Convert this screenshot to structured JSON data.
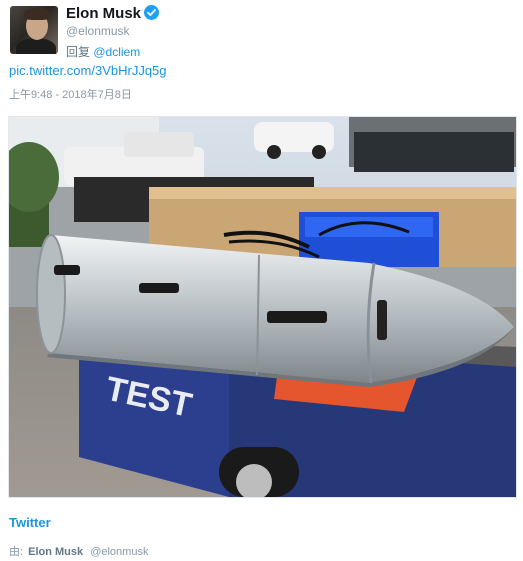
{
  "tweet": {
    "author_name": "Elon Musk",
    "author_handle": "@elonmusk",
    "reply_label": "回复",
    "reply_to": "@dcliem",
    "link_text": "pic.twitter.com/3VbHrJJq5g",
    "timestamp": "上午9:48 - 2018年7月8日",
    "photo_text": "TEST",
    "source_label": "Twitter",
    "via_label": "由:",
    "via_name": "Elon Musk",
    "via_handle": "@elonmusk"
  },
  "icons": {
    "verified": "verified-badge-icon"
  },
  "colors": {
    "link": "#1b95e0",
    "verified": "#1da1f2",
    "muted": "#8899a6"
  }
}
